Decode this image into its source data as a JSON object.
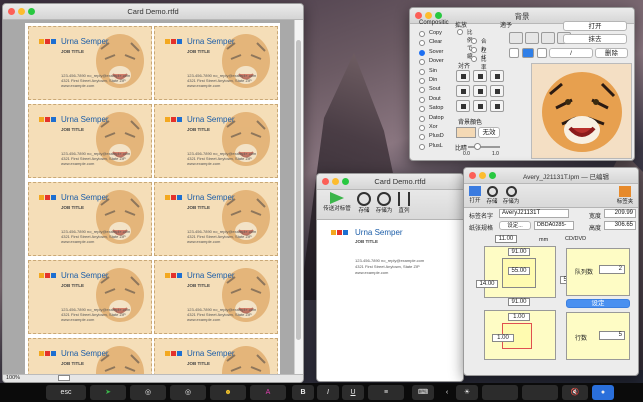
{
  "doc_window": {
    "title": "Card Demo.rtfd",
    "card": {
      "name": "Urna Semper",
      "job": "JOB TITLE",
      "phone": "123-456-7890",
      "email": "no_reply@example.com",
      "address": "4321 First Street  Anytown, State ZIP",
      "web": "www.example.com"
    },
    "zoom": "100%"
  },
  "palette": {
    "title": "背景",
    "composite_label": "Compositic",
    "composite_options": [
      "Copy",
      "Clear",
      "Sover",
      "Dover",
      "Sin",
      "Din",
      "Sout",
      "Dout",
      "Satop",
      "Datop",
      "Xor",
      "PlusD",
      "PlusL"
    ],
    "selected": "Sover",
    "scale_label": "拡放",
    "scale_options": [
      "比例で縮",
      "合わせ",
      "左",
      "比率"
    ],
    "align_label": "対齐",
    "fit_label": "適予",
    "open_btn": "打开",
    "erase_btn": "抹去",
    "delete_btn": "删除",
    "bgcolor_label": "背景顏色",
    "none_btn": "无效",
    "ratio_label": "比睛",
    "ratio_min": "0.0",
    "ratio_max": "1.0"
  },
  "small_window": {
    "title": "Card Demo.rtfd",
    "toolbar": [
      "传送对标管",
      "存储",
      "存储为",
      "直列"
    ],
    "card": {
      "name": "Urna Semper",
      "job": "JOB TITLE",
      "phone": "123-456-7890",
      "email": "no_reply@example.com",
      "address": "4321 First Street  Anytown, State  ZIP",
      "web": "www.example.com"
    }
  },
  "label_window": {
    "title": "Avery_J21131T.lpm — 已编辑",
    "toolbar": [
      "打开",
      "存储",
      "存储为"
    ],
    "right_tool": "标签夹",
    "name_label": "标签名字",
    "name_value": "AveryJ21131T",
    "width_label": "宽度",
    "width_value": "209.99",
    "paper_label": "纸张规格",
    "paper_btn": "设定...",
    "paper_value": "DBDA0285-",
    "height_label": "高度",
    "height_value": "306.65",
    "unit": "mm",
    "cd_label": "CD/DVD",
    "dims": {
      "top": "11.00",
      "w1": "91.00",
      "w2": "55.00",
      "left": "14.00",
      "w3": "91.00",
      "h": "55.00",
      "small1": "1.00",
      "small2": "1.00"
    },
    "cols_label": "队列数",
    "cols_value": "2",
    "rows_label": "行数",
    "rows_value": "5",
    "set_btn": "设定"
  },
  "touchbar": {
    "esc": "esc",
    "bold": "B",
    "italic": "I",
    "underline": "U"
  }
}
